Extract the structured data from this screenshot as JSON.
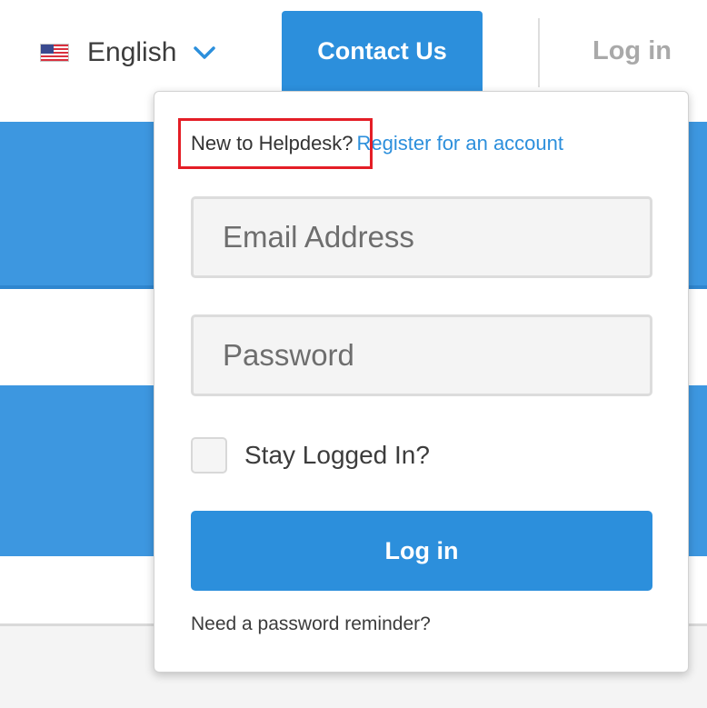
{
  "topbar": {
    "language": {
      "label": "English",
      "flag_icon": "us-flag-icon",
      "chevron_icon": "chevron-down-icon"
    },
    "contact_label": "Contact Us",
    "login_label": "Log in"
  },
  "login_panel": {
    "new_prompt": "New to Helpdesk?",
    "register_link": "Register for an account",
    "email_placeholder": "Email Address",
    "password_placeholder": "Password",
    "stay_logged_in_label": "Stay Logged In?",
    "submit_label": "Log in",
    "reminder_link": "Need a password reminder?"
  },
  "colors": {
    "brand_blue": "#2c8fdc",
    "highlight_red": "#e41e26",
    "muted_text": "#a9a9a9"
  }
}
